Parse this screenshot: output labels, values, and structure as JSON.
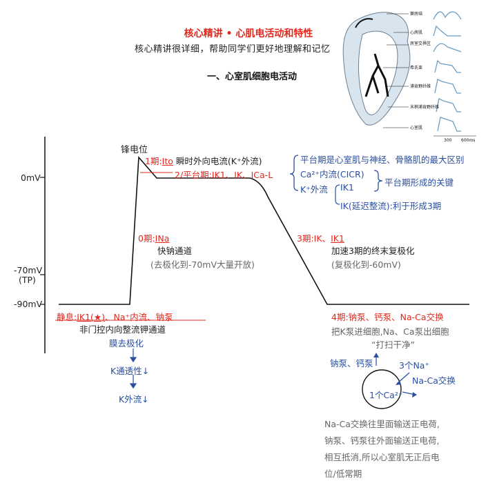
{
  "header": {
    "title": "核心精讲 • 心肌电活动和特性",
    "subtitle": "核心精讲很详细，帮助同学们更好地理解和记忆",
    "section": "一、心室肌细胞电活动"
  },
  "heart_figure": {
    "labels": [
      "窦房结",
      "心房肌",
      "房室交界区",
      "希氏束",
      "浦肯野纤维",
      "末梢浦肯野纤维",
      "心室肌"
    ],
    "axis_ticks": [
      "300",
      "600ms"
    ]
  },
  "axis": {
    "zero": "0mV",
    "tp": "-70mV",
    "tp_note": "(TP)",
    "rest": "-90mV"
  },
  "peak_label": "锋电位",
  "phase1": {
    "name": "1期:",
    "channel": "Ito",
    "desc": "瞬时外向电流(K⁺外流)"
  },
  "phase2": {
    "name": "2/平台期:",
    "channels": "IK1、IK、ICa-L"
  },
  "plateau_notes": {
    "key": "平台期是心室肌与神经、骨骼肌的最大区别",
    "ca": "Ca²⁺内流(CICR)",
    "k": "K⁺外流",
    "ik1": "IK1",
    "ik": "IK(延迟整流):利于形成3期",
    "formation": "平台期形成的关键"
  },
  "phase0": {
    "name": "0期:",
    "channel": "INa",
    "desc": "快钠通道",
    "note": "(去极化到-70mV大量开放)"
  },
  "phase3": {
    "name": "3期:IK、",
    "channel": "IK1",
    "desc": "加速3期的终末复极化",
    "note": "(复极化到-60mV)"
  },
  "phase4": {
    "label": "4期:钠泵、钙泵、Na-Ca交换",
    "desc1": "把K泵进细胞,Na、Ca泵出细胞",
    "desc2": "“打扫干净”"
  },
  "rest_state": {
    "label": "静息:",
    "channel": "IK1(★)",
    "rest_of_label": "、Na⁺内流、钠泵",
    "line1": "非门控内向整流钾通道",
    "line2": "膜去极化",
    "line3": "K通透性↓",
    "line4": "K外流↓"
  },
  "cell_diagram": {
    "pumps": "钠泵、钙泵",
    "na": "3个Na⁺",
    "exchange": "Na-Ca交换",
    "ca": "1个Ca²⁺"
  },
  "conclusion": [
    "Na-Ca交换往里面输送正电荷,",
    "钠泵、钙泵往外面输送正电荷,",
    "相互抵消,所以心室肌无正后电",
    "位/低常期"
  ]
}
